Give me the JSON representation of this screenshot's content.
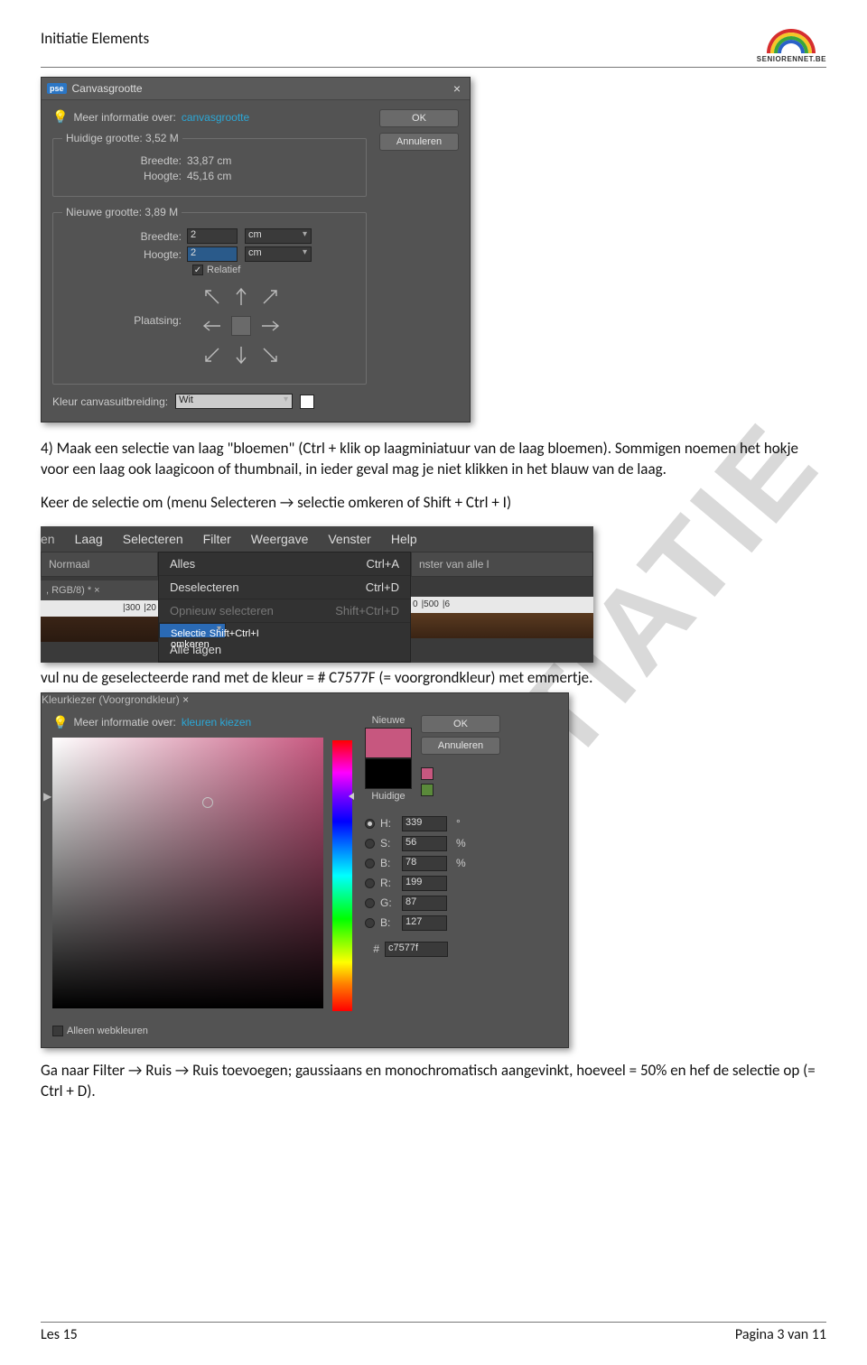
{
  "header": {
    "title": "Initiatie Elements",
    "logo_caption": "SENIORENNET.BE"
  },
  "watermark": "INITIATIE",
  "canvas_dialog": {
    "title": "Canvasgrootte",
    "info_prefix": "Meer informatie over:",
    "info_link": "canvasgrootte",
    "ok": "OK",
    "cancel": "Annuleren",
    "current_group": "Huidige grootte: 3,52 M",
    "cur_width_label": "Breedte:",
    "cur_width_value": "33,87 cm",
    "cur_height_label": "Hoogte:",
    "cur_height_value": "45,16 cm",
    "new_group": "Nieuwe grootte: 3,89 M",
    "new_width_label": "Breedte:",
    "new_width_value": "2",
    "new_height_label": "Hoogte:",
    "new_height_value": "2",
    "unit": "cm",
    "relative_label": "Relatief",
    "placement_label": "Plaatsing:",
    "ext_label": "Kleur canvasuitbreiding:",
    "ext_value": "Wit"
  },
  "para1": "4) Maak een selectie van laag \"bloemen\"  (Ctrl + klik op laagminiatuur van de laag bloemen). Sommigen noemen het hokje voor een laag ook laagicoon of thumbnail, in ieder geval mag je niet klikken in het blauw van de laag.",
  "para2": "Keer de selectie om (menu Selecteren → selectie omkeren of Shift + Ctrl + I)",
  "menu": {
    "bar": [
      "en",
      "Laag",
      "Selecteren",
      "Filter",
      "Weergave",
      "Venster",
      "Help"
    ],
    "normaal": "Normaal",
    "tab": ", RGB/8) *  ×",
    "right_text": "nster van alle l",
    "ruler_left_ticks": [
      "|300",
      "|20"
    ],
    "ruler_right_ticks": [
      "0",
      "|500",
      "|6"
    ],
    "items": [
      {
        "label": "Alles",
        "shortcut": "Ctrl+A",
        "state": "normal"
      },
      {
        "label": "Deselecteren",
        "shortcut": "Ctrl+D",
        "state": "normal"
      },
      {
        "label": "Opnieuw selecteren",
        "shortcut": "Shift+Ctrl+D",
        "state": "disabled"
      },
      {
        "label": "Selectie omkeren",
        "shortcut": "Shift+Ctrl+I",
        "state": "sel"
      },
      {
        "label": "Alle lagen",
        "shortcut": "",
        "state": "normal"
      }
    ]
  },
  "para3": " vul nu de geselecteerde rand met de kleur = # C7577F  (= voorgrondkleur) met emmertje.",
  "picker": {
    "title": "Kleurkiezer (Voorgrondkleur)",
    "info_prefix": "Meer informatie over:",
    "info_link": "kleuren kiezen",
    "ok": "OK",
    "cancel": "Annuleren",
    "new_label": "Nieuwe",
    "current_label": "Huidige",
    "fields": [
      {
        "key": "H",
        "val": "339",
        "unit": "°",
        "on": true
      },
      {
        "key": "S",
        "val": "56",
        "unit": "%",
        "on": false
      },
      {
        "key": "B",
        "val": "78",
        "unit": "%",
        "on": false
      },
      {
        "key": "R",
        "val": "199",
        "unit": "",
        "on": false
      },
      {
        "key": "G",
        "val": "87",
        "unit": "",
        "on": false
      },
      {
        "key": "B",
        "val": "127",
        "unit": "",
        "on": false
      }
    ],
    "hex_label": "#",
    "hex_value": "c7577f",
    "web_only": "Alleen webkleuren",
    "colors": {
      "new": "#c7577f",
      "current": "#000000",
      "tiny1": "#c7577f",
      "tiny2": "#5a8a3a"
    }
  },
  "para4": "Ga naar Filter → Ruis → Ruis toevoegen; gaussiaans en monochromatisch aangevinkt, hoeveel = 50% en hef de selectie op (= Ctrl + D).",
  "footer": {
    "left": "Les 15",
    "right": "Pagina 3 van 11"
  }
}
